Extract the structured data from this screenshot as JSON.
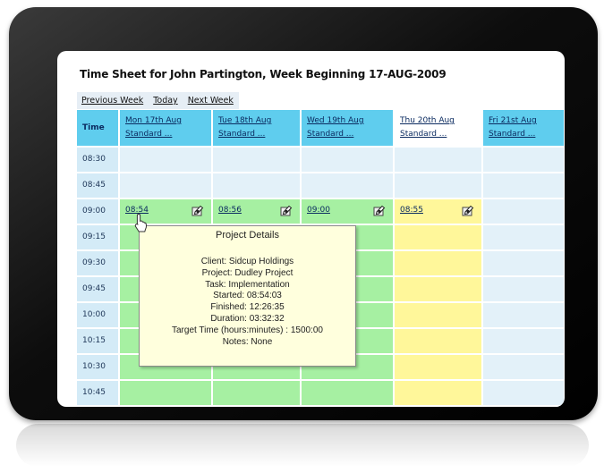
{
  "page": {
    "title": "Time Sheet for John Partington, Week Beginning 17-AUG-2009"
  },
  "nav": {
    "previous_week": "Previous Week",
    "today": "Today",
    "next_week": "Next Week"
  },
  "grid": {
    "time_header": "Time",
    "days": [
      {
        "date": "Mon 17th Aug",
        "type": "Standard ..."
      },
      {
        "date": "Tue 18th Aug",
        "type": "Standard ..."
      },
      {
        "date": "Wed 19th Aug",
        "type": "Standard ..."
      },
      {
        "date": "Thu 20th Aug",
        "type": "Standard ..."
      },
      {
        "date": "Fri 21st Aug",
        "type": "Standard ..."
      }
    ],
    "times": [
      "08:30",
      "08:45",
      "09:00",
      "09:15",
      "09:30",
      "09:45",
      "10:00",
      "10:15",
      "10:30",
      "10:45"
    ],
    "entries": [
      "08:54",
      "08:56",
      "09:00",
      "08:55"
    ],
    "colors": {
      "header": "#5fcdee",
      "empty": "#e3f1f9",
      "time_col": "#d4ebf7",
      "booked": "#a6f0a2",
      "booked_alt": "#fff79a"
    }
  },
  "tooltip": {
    "title": "Project Details",
    "client": "Client: Sidcup Holdings",
    "project": "Project: Dudley Project",
    "task": "Task: Implementation",
    "started": "Started: 08:54:03",
    "finished": "Finished: 12:26:35",
    "duration": "Duration: 03:32:32",
    "target": "Target Time (hours:minutes) : 1500:00",
    "notes": "Notes: None"
  },
  "icons": {
    "entry_icon": "edit-entry-icon",
    "cursor": "hand-pointer-icon"
  }
}
